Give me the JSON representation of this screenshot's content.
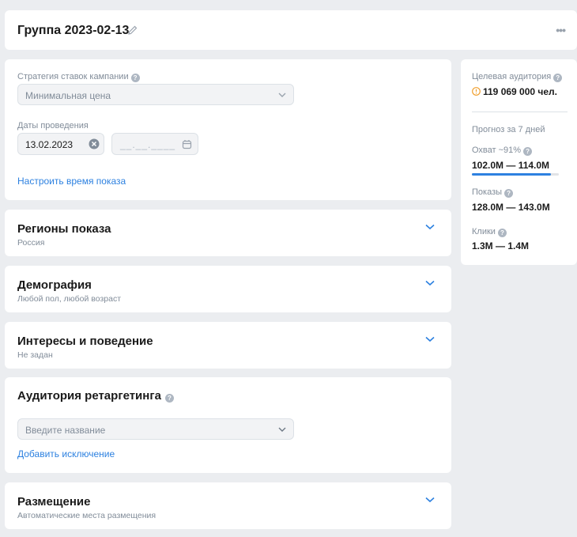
{
  "header": {
    "title": "Группа 2023-02-13",
    "more": "•••"
  },
  "strategy": {
    "label": "Стратегия ставок кампании",
    "value": "Минимальная цена"
  },
  "dates": {
    "label": "Даты проведения",
    "start": "13.02.2023",
    "end_placeholder": "__.__.____"
  },
  "schedule_link": "Настроить время показа",
  "sections": {
    "regions": {
      "title": "Регионы показа",
      "subtitle": "Россия"
    },
    "demography": {
      "title": "Демография",
      "subtitle": "Любой пол, любой возраст"
    },
    "interests": {
      "title": "Интересы и поведение",
      "subtitle": "Не задан"
    },
    "placement": {
      "title": "Размещение",
      "subtitle": "Автоматические места размещения"
    }
  },
  "retargeting": {
    "title": "Аудитория ретаргетинга",
    "placeholder": "Введите название",
    "add_exclusion": "Добавить исключение"
  },
  "sidebar": {
    "audience_label": "Целевая аудитория",
    "audience_value": "119 069 000 чел.",
    "forecast_label": "Прогноз за 7 дней",
    "reach_label": "Охват ~91%",
    "reach_value": "102.0M — 114.0M",
    "reach_fraction": 0.91,
    "impressions_label": "Показы",
    "impressions_value": "128.0M — 143.0M",
    "clicks_label": "Клики",
    "clicks_value": "1.3M — 1.4M"
  },
  "colors": {
    "accent": "#2d81e0",
    "warning": "#f0a030",
    "muted": "#818c99"
  }
}
